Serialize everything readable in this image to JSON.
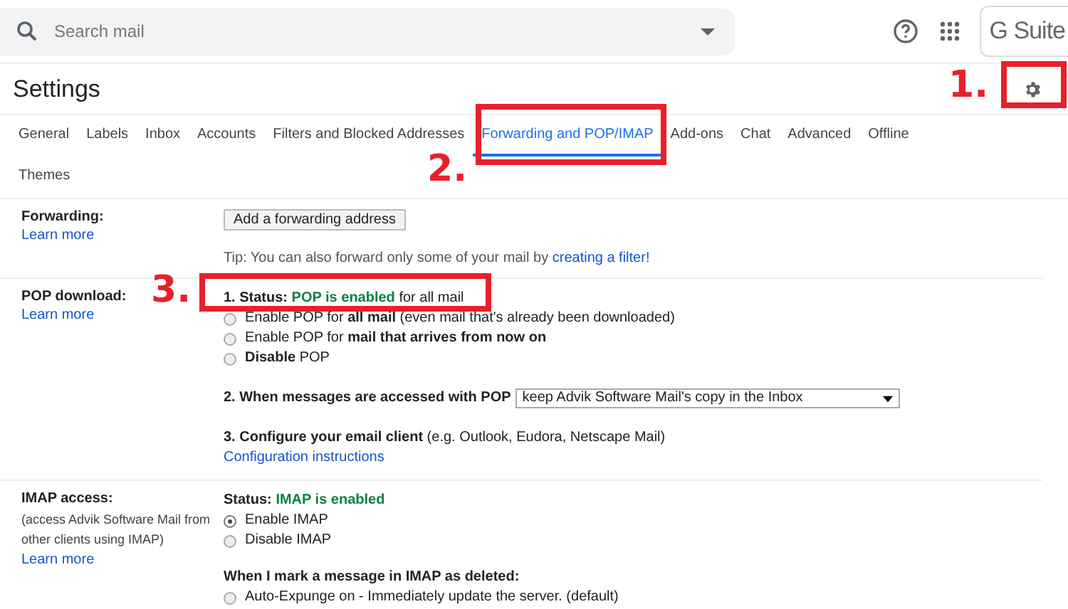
{
  "search": {
    "placeholder": "Search mail"
  },
  "brand": {
    "logo_text": "G Suite"
  },
  "page_title": "Settings",
  "tabs": [
    {
      "label": "General",
      "selected": false
    },
    {
      "label": "Labels",
      "selected": false
    },
    {
      "label": "Inbox",
      "selected": false
    },
    {
      "label": "Accounts",
      "selected": false
    },
    {
      "label": "Filters and Blocked Addresses",
      "selected": false
    },
    {
      "label": "Forwarding and POP/IMAP",
      "selected": true
    },
    {
      "label": "Add-ons",
      "selected": false
    },
    {
      "label": "Chat",
      "selected": false
    },
    {
      "label": "Advanced",
      "selected": false
    },
    {
      "label": "Offline",
      "selected": false
    },
    {
      "label": "Themes",
      "selected": false
    }
  ],
  "forwarding": {
    "label": "Forwarding:",
    "learn_more": "Learn more",
    "button": "Add a forwarding address",
    "tip": "Tip: You can also forward only some of your mail by",
    "tip_link": "creating a filter!"
  },
  "pop": {
    "label": "POP download:",
    "learn_more": "Learn more",
    "status_prefix": "1. Status:",
    "status_value": "POP is enabled",
    "status_suffix": "for all mail",
    "options": [
      {
        "text": "Enable POP for **all mail** (even mail that's already been downloaded)",
        "selected": false
      },
      {
        "text": "Enable POP for **mail that arrives from now on**",
        "selected": false
      },
      {
        "text": "**Disable** POP",
        "selected": false
      }
    ],
    "access_label": "2. When messages are accessed with POP",
    "access_value": "keep Advik Software Mail's copy in the Inbox",
    "configure": "**3. Configure your email client** (e.g. Outlook, Eudora, Netscape Mail)",
    "configure_link": "Configuration instructions"
  },
  "imap": {
    "label": "IMAP access:",
    "note": "(access Advik Software Mail from other clients using IMAP)",
    "learn_more": "Learn more",
    "status_prefix": "Status:",
    "status_value": "IMAP is enabled",
    "options": [
      {
        "text": "Enable IMAP",
        "selected": true
      },
      {
        "text": "Disable IMAP",
        "selected": false
      }
    ],
    "deleted_heading": "When I mark a message in IMAP as deleted:",
    "deleted_option": "Auto-Expunge on - Immediately update the server. (default)"
  },
  "annotations": [
    {
      "number": "1."
    },
    {
      "number": "2."
    },
    {
      "number": "3."
    }
  ]
}
